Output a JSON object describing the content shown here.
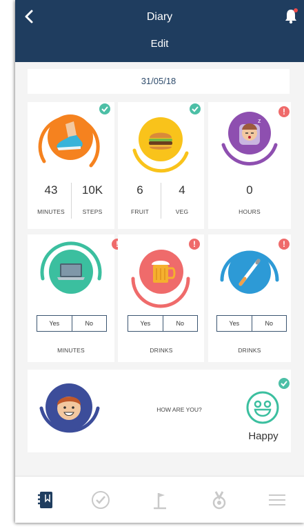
{
  "header": {
    "title": "Diary",
    "subtitle": "Edit"
  },
  "date": "31/05/18",
  "cards": {
    "exercise": {
      "minutes_value": "43",
      "minutes_label": "MINUTES",
      "steps_value": "10K",
      "steps_label": "STEPS"
    },
    "food": {
      "fruit_value": "6",
      "fruit_label": "FRUIT",
      "veg_value": "4",
      "veg_label": "VEG"
    },
    "sleep": {
      "hours_value": "0",
      "hours_label": "HOURS"
    },
    "screen": {
      "yes": "Yes",
      "no": "No",
      "label": "MINUTES"
    },
    "alcohol": {
      "yes": "Yes",
      "no": "No",
      "label": "DRINKS"
    },
    "smoking": {
      "yes": "Yes",
      "no": "No",
      "label": "DRINKS"
    }
  },
  "mood": {
    "question": "HOW ARE YOU?",
    "value": "Happy"
  },
  "colors": {
    "header": "#1f3d5f",
    "orange": "#f5821f",
    "yellow": "#f9c31b",
    "purple": "#8e4fb0",
    "teal": "#3bbf9f",
    "red": "#ef6b6b",
    "blue": "#2d9ad6",
    "navy": "#3c4d9a",
    "check": "#4cbfa6",
    "alert": "#ef6b6b"
  },
  "nav": {
    "items": [
      "diary-icon",
      "check-circle-icon",
      "flag-icon",
      "medal-icon",
      "menu-icon"
    ]
  }
}
